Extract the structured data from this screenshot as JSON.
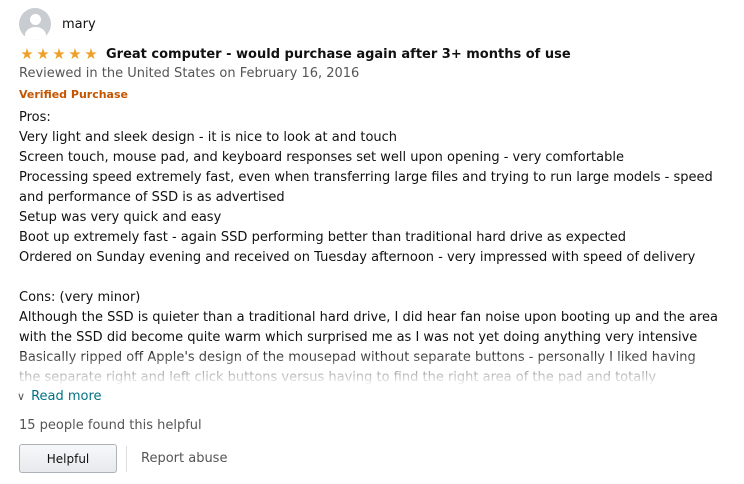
{
  "review": {
    "reviewer_name": "mary",
    "rating": 5,
    "star_glyph": "★",
    "star_color": "#f0a028",
    "title": "Great computer - would purchase again after 3+ months of use",
    "date_line": "Reviewed in the United States on February 16, 2016",
    "verified_label": "Verified Purchase",
    "verified_color": "#c45500",
    "body_lines": [
      "Pros:",
      "Very light and sleek design - it is nice to look at and touch",
      "Screen touch, mouse pad, and keyboard responses set well upon opening - very comfortable",
      "Processing speed extremely fast, even when transferring large files and trying to run large models - speed",
      "and performance of SSD is as advertised",
      "Setup was very quick and easy",
      "Boot up extremely fast - again SSD performing better than traditional hard drive as expected",
      "Ordered on Sunday evening and received on Tuesday afternoon - very impressed with speed of delivery",
      "",
      "Cons: (very minor)",
      "Although the SSD is quieter than a traditional hard drive, I did hear fan noise upon booting up and the area",
      "with the SSD did become quite warm which surprised me as I was not yet doing anything very intensive",
      "Basically ripped off Apple's design of the mousepad without separate buttons - personally I liked having",
      "the separate right and left click buttons versus having to find the right area of the pad and totally"
    ],
    "read_more_label": "Read more",
    "read_more_icon": "chevron-down-icon",
    "helpful_count_text": "15 people found this helpful",
    "helpful_button_label": "Helpful",
    "report_label": "Report abuse",
    "link_color": "#007185"
  }
}
